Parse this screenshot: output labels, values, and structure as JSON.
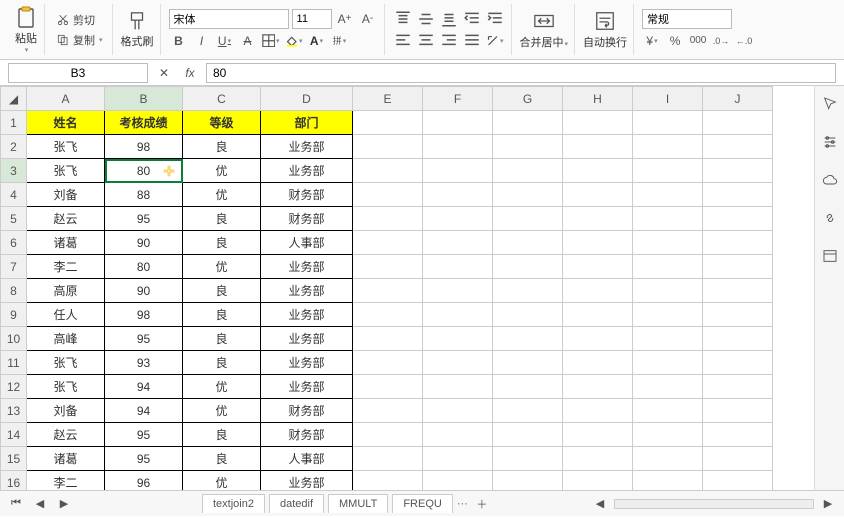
{
  "ribbon": {
    "paste": "粘贴",
    "cut": "剪切",
    "copy": "复制",
    "format_painter": "格式刷",
    "font_name": "宋体",
    "font_size": "11",
    "merge_center": "合并居中",
    "wrap_text": "自动换行",
    "number_format": "常规"
  },
  "namebox": "B3",
  "formula_value": "80",
  "columns": [
    "A",
    "B",
    "C",
    "D",
    "E",
    "F",
    "G",
    "H",
    "I",
    "J"
  ],
  "headers": {
    "A": "姓名",
    "B": "考核成绩",
    "C": "等级",
    "D": "部门"
  },
  "rows": [
    {
      "n": 2,
      "A": "张飞",
      "B": "98",
      "C": "良",
      "D": "业务部"
    },
    {
      "n": 3,
      "A": "张飞",
      "B": "80",
      "C": "优",
      "D": "业务部"
    },
    {
      "n": 4,
      "A": "刘备",
      "B": "88",
      "C": "优",
      "D": "财务部"
    },
    {
      "n": 5,
      "A": "赵云",
      "B": "95",
      "C": "良",
      "D": "财务部"
    },
    {
      "n": 6,
      "A": "诸葛",
      "B": "90",
      "C": "良",
      "D": "人事部"
    },
    {
      "n": 7,
      "A": "李二",
      "B": "80",
      "C": "优",
      "D": "业务部"
    },
    {
      "n": 8,
      "A": "高原",
      "B": "90",
      "C": "良",
      "D": "业务部"
    },
    {
      "n": 9,
      "A": "任人",
      "B": "98",
      "C": "良",
      "D": "业务部"
    },
    {
      "n": 10,
      "A": "高峰",
      "B": "95",
      "C": "良",
      "D": "业务部"
    },
    {
      "n": 11,
      "A": "张飞",
      "B": "93",
      "C": "良",
      "D": "业务部"
    },
    {
      "n": 12,
      "A": "张飞",
      "B": "94",
      "C": "优",
      "D": "业务部"
    },
    {
      "n": 13,
      "A": "刘备",
      "B": "94",
      "C": "优",
      "D": "财务部"
    },
    {
      "n": 14,
      "A": "赵云",
      "B": "95",
      "C": "良",
      "D": "财务部"
    },
    {
      "n": 15,
      "A": "诸葛",
      "B": "95",
      "C": "良",
      "D": "人事部"
    },
    {
      "n": 16,
      "A": "李二",
      "B": "96",
      "C": "优",
      "D": "业务部"
    }
  ],
  "active": {
    "cell": "B3",
    "row": 3,
    "col": "B"
  },
  "tabs": [
    "textjoin2",
    "datedif",
    "MMULT",
    "FREQU"
  ],
  "chart_data": {
    "type": "table",
    "columns": [
      "姓名",
      "考核成绩",
      "等级",
      "部门"
    ],
    "data": [
      [
        "张飞",
        98,
        "良",
        "业务部"
      ],
      [
        "张飞",
        80,
        "优",
        "业务部"
      ],
      [
        "刘备",
        88,
        "优",
        "财务部"
      ],
      [
        "赵云",
        95,
        "良",
        "财务部"
      ],
      [
        "诸葛",
        90,
        "良",
        "人事部"
      ],
      [
        "李二",
        80,
        "优",
        "业务部"
      ],
      [
        "高原",
        90,
        "良",
        "业务部"
      ],
      [
        "任人",
        98,
        "良",
        "业务部"
      ],
      [
        "高峰",
        95,
        "良",
        "业务部"
      ],
      [
        "张飞",
        93,
        "良",
        "业务部"
      ],
      [
        "张飞",
        94,
        "优",
        "业务部"
      ],
      [
        "刘备",
        94,
        "优",
        "财务部"
      ],
      [
        "赵云",
        95,
        "良",
        "财务部"
      ],
      [
        "诸葛",
        95,
        "良",
        "人事部"
      ],
      [
        "李二",
        96,
        "优",
        "业务部"
      ]
    ]
  }
}
